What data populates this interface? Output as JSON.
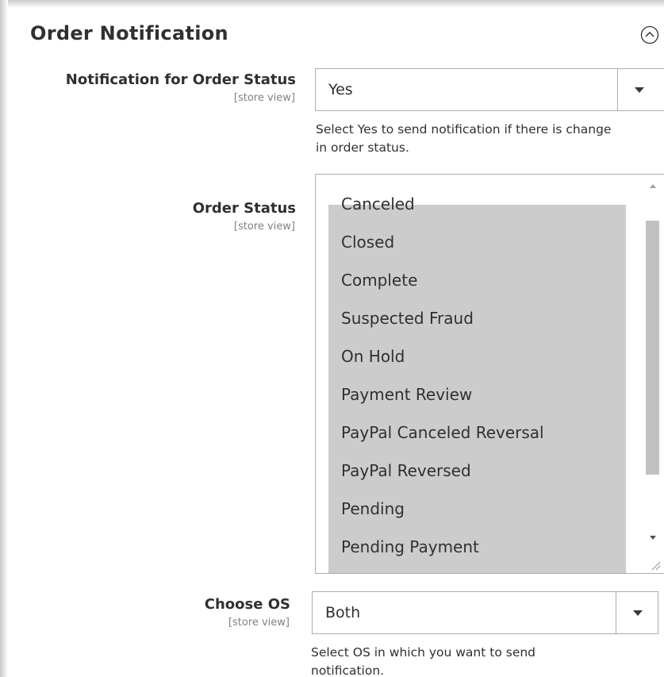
{
  "section": {
    "title": "Order Notification",
    "collapse_icon": "circle-chevron-up-icon"
  },
  "fields": {
    "notification_for_order_status": {
      "label": "Notification for Order Status",
      "scope": "[store view]",
      "value": "Yes",
      "note": [
        "Select Yes to send notification if there is change",
        "in order status."
      ]
    },
    "order_status": {
      "label": "Order Status",
      "scope": "[store view]",
      "options": [
        "Canceled",
        "Closed",
        "Complete",
        "Suspected Fraud",
        "On Hold",
        "Payment Review",
        "PayPal Canceled Reversal",
        "PayPal Reversed",
        "Pending",
        "Pending Payment"
      ]
    },
    "choose_os": {
      "label": "Choose OS",
      "scope": "[store view]",
      "value": "Both",
      "note": [
        "Select OS in which you want to send",
        "notification."
      ]
    }
  },
  "colors": {
    "selected_option_bg": "#cccccc",
    "border": "#adadad",
    "text": "#303030",
    "scope_text": "#808080"
  }
}
